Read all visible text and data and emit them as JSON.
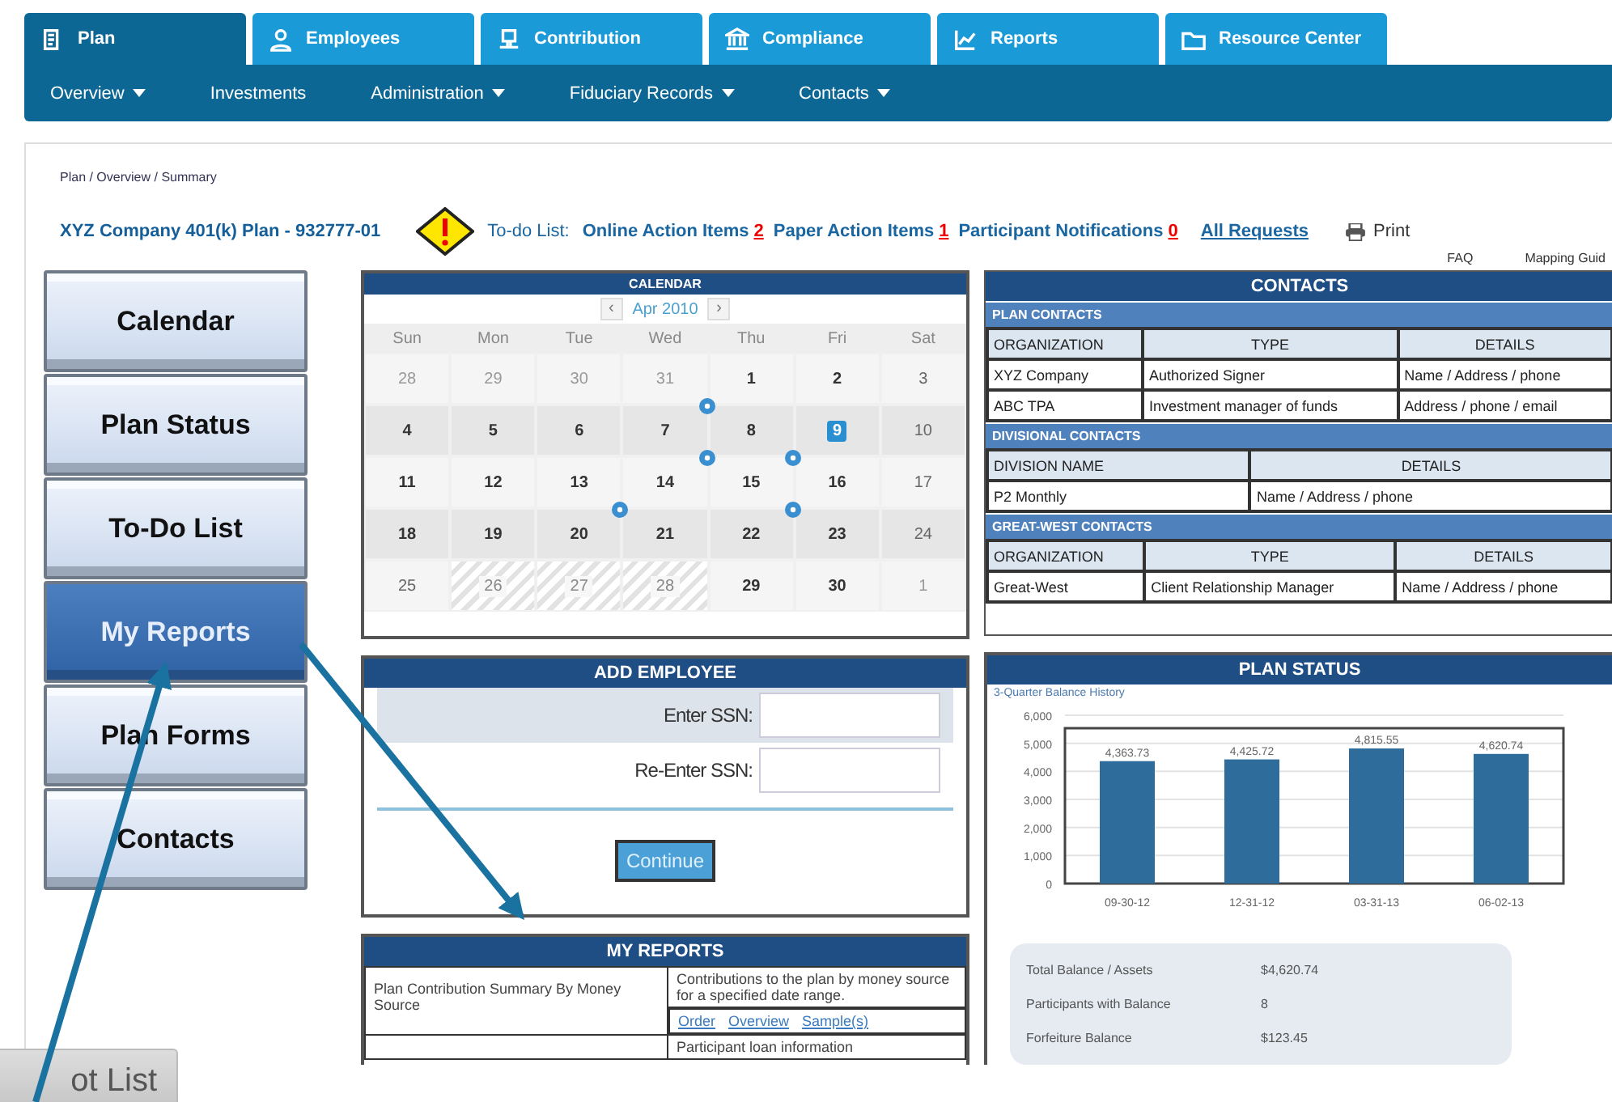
{
  "tabs": [
    {
      "label": "Plan",
      "selected": true
    },
    {
      "label": "Employees",
      "selected": false
    },
    {
      "label": "Contribution",
      "selected": false
    },
    {
      "label": "Compliance",
      "selected": false
    },
    {
      "label": "Reports",
      "selected": false
    },
    {
      "label": "Resource Center",
      "selected": false
    }
  ],
  "nav": [
    {
      "label": "Overview",
      "dropdown": true
    },
    {
      "label": "Investments",
      "dropdown": false
    },
    {
      "label": "Administration",
      "dropdown": true
    },
    {
      "label": "Fiduciary Records",
      "dropdown": true
    },
    {
      "label": "Contacts",
      "dropdown": true
    }
  ],
  "breadcrumb": "Plan / Overview / Summary",
  "plan_title": "XYZ Company 401(k) Plan - 932777-01",
  "todo": {
    "label": "To-do List:",
    "items": [
      {
        "label": "Online Action Items",
        "count": "2"
      },
      {
        "label": "Paper Action Items",
        "count": "1"
      },
      {
        "label": "Participant Notifications",
        "count": "0"
      }
    ],
    "all_link": "All Requests"
  },
  "print": "Print",
  "header_links": [
    "FAQ",
    "Mapping Guid"
  ],
  "sidebar": [
    {
      "label": "Calendar",
      "selected": false
    },
    {
      "label": "Plan Status",
      "selected": false
    },
    {
      "label": "To-Do List",
      "selected": false
    },
    {
      "label": "My Reports",
      "selected": true
    },
    {
      "label": "Plan Forms",
      "selected": false
    },
    {
      "label": "Contacts",
      "selected": false
    }
  ],
  "bottom_button": "ot List",
  "calendar": {
    "title": "CALENDAR",
    "prev": "‹",
    "month": "Apr 2010",
    "next": "›",
    "weekdays": [
      "Sun",
      "Mon",
      "Tue",
      "Wed",
      "Thu",
      "Fri",
      "Sat"
    ],
    "days": [
      {
        "d": "28",
        "kind": "other",
        "selected": false
      },
      {
        "d": "29",
        "kind": "other",
        "selected": false
      },
      {
        "d": "30",
        "kind": "other",
        "selected": false
      },
      {
        "d": "31",
        "kind": "other",
        "selected": false
      },
      {
        "d": "1",
        "kind": "normal",
        "selected": false
      },
      {
        "d": "2",
        "kind": "normal",
        "selected": false
      },
      {
        "d": "3",
        "kind": "weekend",
        "selected": false
      },
      {
        "d": "4",
        "kind": "normal",
        "selected": false
      },
      {
        "d": "5",
        "kind": "normal",
        "selected": false
      },
      {
        "d": "6",
        "kind": "normal",
        "selected": false
      },
      {
        "d": "7",
        "kind": "normal",
        "selected": false,
        "event": true
      },
      {
        "d": "8",
        "kind": "normal",
        "selected": false
      },
      {
        "d": "9",
        "kind": "normal",
        "selected": true
      },
      {
        "d": "10",
        "kind": "weekend",
        "selected": false
      },
      {
        "d": "11",
        "kind": "normal",
        "selected": false
      },
      {
        "d": "12",
        "kind": "normal",
        "selected": false
      },
      {
        "d": "13",
        "kind": "normal",
        "selected": false
      },
      {
        "d": "14",
        "kind": "normal",
        "selected": false,
        "event": true
      },
      {
        "d": "15",
        "kind": "normal",
        "selected": false,
        "event": true
      },
      {
        "d": "16",
        "kind": "normal",
        "selected": false
      },
      {
        "d": "17",
        "kind": "weekend",
        "selected": false
      },
      {
        "d": "18",
        "kind": "normal",
        "selected": false
      },
      {
        "d": "19",
        "kind": "normal",
        "selected": false
      },
      {
        "d": "20",
        "kind": "normal",
        "selected": false,
        "event": true
      },
      {
        "d": "21",
        "kind": "normal",
        "selected": false
      },
      {
        "d": "22",
        "kind": "normal",
        "selected": false,
        "event": true
      },
      {
        "d": "23",
        "kind": "normal",
        "selected": false
      },
      {
        "d": "24",
        "kind": "weekend",
        "selected": false
      },
      {
        "d": "25",
        "kind": "weekend",
        "selected": false
      },
      {
        "d": "26",
        "kind": "hatched",
        "selected": false
      },
      {
        "d": "27",
        "kind": "hatched",
        "selected": false
      },
      {
        "d": "28",
        "kind": "hatched",
        "selected": false
      },
      {
        "d": "29",
        "kind": "normal",
        "selected": false
      },
      {
        "d": "30",
        "kind": "normal",
        "selected": false
      },
      {
        "d": "1",
        "kind": "other",
        "selected": false
      }
    ]
  },
  "add_employee": {
    "title": "ADD EMPLOYEE",
    "fields": [
      {
        "label": "Enter SSN:"
      },
      {
        "label": "Re-Enter SSN:"
      }
    ],
    "button": "Continue"
  },
  "my_reports": {
    "title": "MY REPORTS",
    "rows": [
      {
        "name": "Plan Contribution  Summary By Money Source",
        "description": "Contributions to the plan by money source for a specified date range.",
        "links": [
          "Order",
          "Overview",
          "Sample(s)"
        ]
      },
      {
        "name": "",
        "description": "Participant loan information",
        "links": []
      }
    ]
  },
  "contacts": {
    "title": "CONTACTS",
    "sections": [
      {
        "title": "PLAN CONTACTS",
        "columns": [
          "ORGANIZATION",
          "TYPE",
          "DETAILS"
        ],
        "rows": [
          [
            "XYZ Company",
            "Authorized Signer",
            "Name / Address / phone"
          ],
          [
            "ABC TPA",
            "Investment manager of funds",
            "Address / phone / email"
          ]
        ]
      },
      {
        "title": "DIVISIONAL CONTACTS",
        "columns": [
          "DIVISION NAME",
          "DETAILS"
        ],
        "rows": [
          [
            "P2 Monthly",
            "Name / Address / phone"
          ]
        ]
      },
      {
        "title": "GREAT-WEST CONTACTS",
        "columns": [
          "ORGANIZATION",
          "TYPE",
          "DETAILS"
        ],
        "rows": [
          [
            "Great-West",
            "Client Relationship Manager",
            "Name / Address / phone"
          ]
        ]
      }
    ]
  },
  "plan_status": {
    "title": "PLAN STATUS",
    "chart_data": {
      "type": "bar",
      "grid": true,
      "title": "3-Quarter Balance History",
      "categories": [
        "09-30-12",
        "12-31-12",
        "03-31-13",
        "06-02-13"
      ],
      "values": [
        4363.73,
        4425.72,
        4815.55,
        4620.74
      ],
      "ylim": [
        0,
        6000
      ],
      "yticks": [
        0,
        {
          "value": 1000,
          "label": "1,000"
        },
        {
          "value": 2000,
          "label": "2,000"
        },
        {
          "value": 3000,
          "label": "3,000"
        },
        {
          "value": 4000,
          "label": "4,000"
        },
        {
          "value": 5000,
          "label": "5,000"
        },
        {
          "value": 6000,
          "label": "6,000"
        }
      ],
      "data_labels": true,
      "value_labels": [
        "4,363.73",
        "4,425.72",
        "4,815.55",
        "4,620.74"
      ]
    },
    "summary": [
      {
        "label": "Total Balance / Assets",
        "value": "$4,620.74"
      },
      {
        "label": "Participants with Balance",
        "value": "8"
      },
      {
        "label": "Forfeiture Balance",
        "value": "$123.45"
      }
    ]
  }
}
